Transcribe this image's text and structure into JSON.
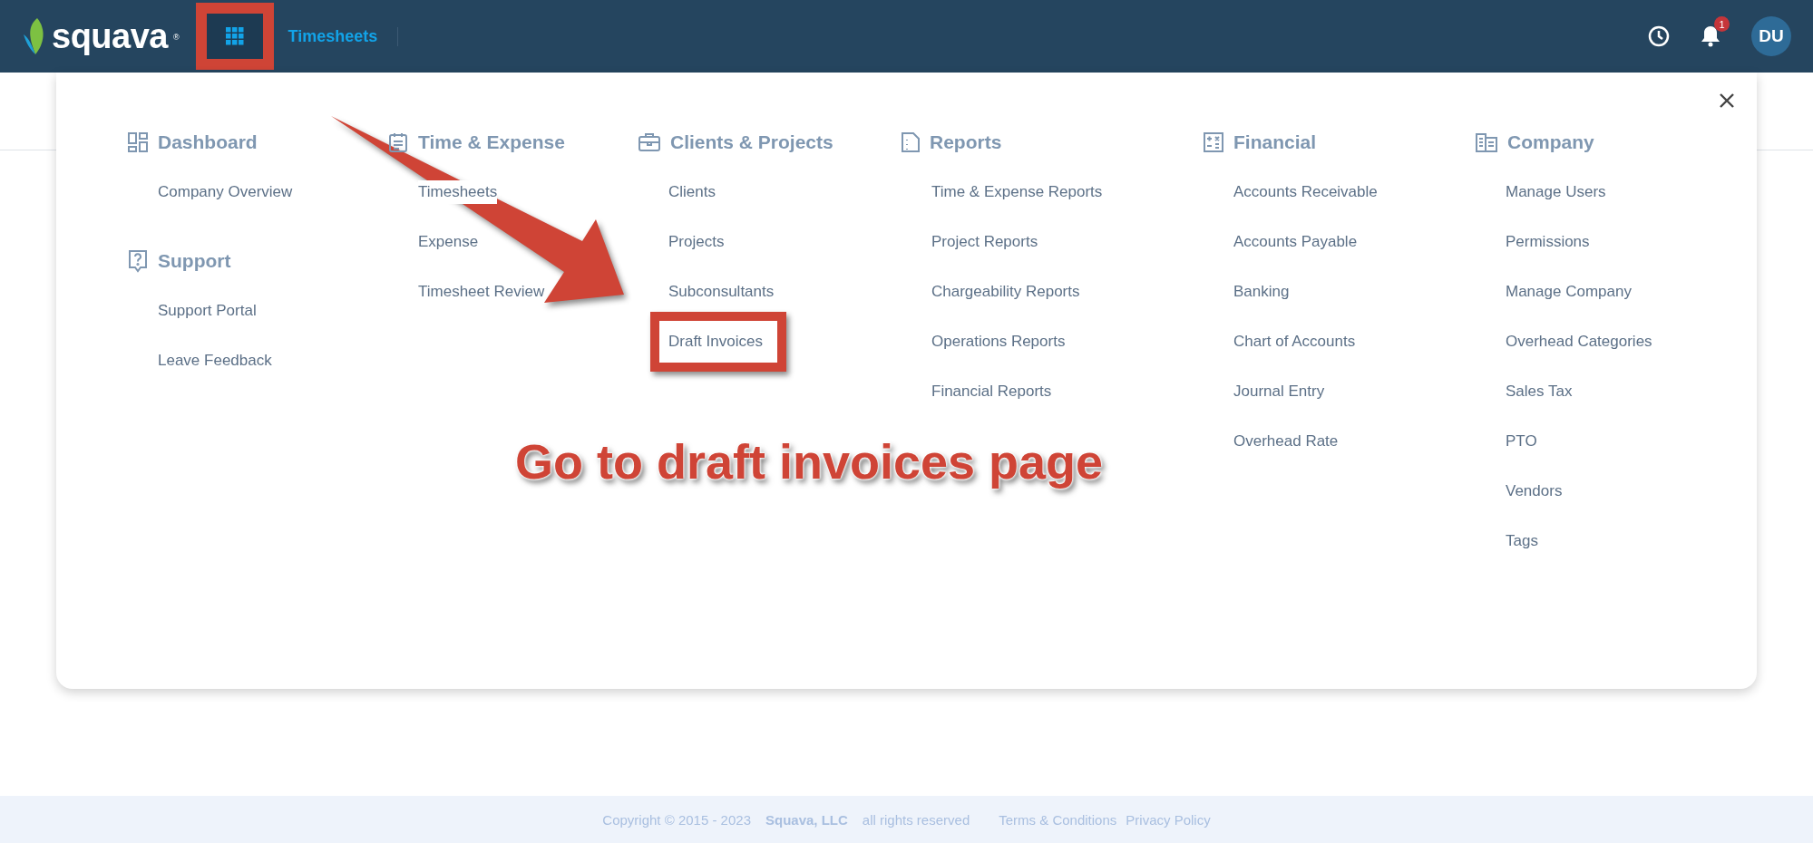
{
  "header": {
    "logo": {
      "name": "squava",
      "mark": "®"
    },
    "apps_button": {
      "boxed": true
    },
    "app_title": "Timesheets",
    "notifications": {
      "badge": "1"
    },
    "avatar": "DU"
  },
  "menu": {
    "columns": [
      {
        "sections": [
          {
            "title": "Dashboard",
            "items": [
              {
                "label": "Company Overview",
                "boxed": false
              }
            ]
          },
          {
            "title": "Support",
            "items": [
              {
                "label": "Support Portal",
                "boxed": false
              },
              {
                "label": "Leave Feedback",
                "boxed": false
              }
            ]
          }
        ]
      },
      {
        "sections": [
          {
            "title": "Time & Expense",
            "items": [
              {
                "label": "Timesheets",
                "boxed": false
              },
              {
                "label": "Expense",
                "boxed": false
              },
              {
                "label": "Timesheet Review",
                "boxed": false
              }
            ]
          }
        ]
      },
      {
        "sections": [
          {
            "title": "Clients & Projects",
            "items": [
              {
                "label": "Clients",
                "boxed": false
              },
              {
                "label": "Projects",
                "boxed": false
              },
              {
                "label": "Subconsultants",
                "boxed": false
              },
              {
                "label": "Draft Invoices",
                "boxed": true
              }
            ]
          }
        ]
      },
      {
        "sections": [
          {
            "title": "Reports",
            "items": [
              {
                "label": "Time & Expense Reports",
                "boxed": false
              },
              {
                "label": "Project Reports",
                "boxed": false
              },
              {
                "label": "Chargeability Reports",
                "boxed": false
              },
              {
                "label": "Operations Reports",
                "boxed": false
              },
              {
                "label": "Financial Reports",
                "boxed": false
              }
            ]
          }
        ]
      },
      {
        "sections": [
          {
            "title": "Financial",
            "items": [
              {
                "label": "Accounts Receivable",
                "boxed": false
              },
              {
                "label": "Accounts Payable",
                "boxed": false
              },
              {
                "label": "Banking",
                "boxed": false
              },
              {
                "label": "Chart of Accounts",
                "boxed": false
              },
              {
                "label": "Journal Entry",
                "boxed": false
              },
              {
                "label": "Overhead Rate",
                "boxed": false
              }
            ]
          }
        ]
      },
      {
        "sections": [
          {
            "title": "Company",
            "items": [
              {
                "label": "Manage Users",
                "boxed": false
              },
              {
                "label": "Permissions",
                "boxed": false
              },
              {
                "label": "Manage Company",
                "boxed": false
              },
              {
                "label": "Overhead Categories",
                "boxed": false
              },
              {
                "label": "Sales Tax",
                "boxed": false
              },
              {
                "label": "PTO",
                "boxed": false
              },
              {
                "label": "Vendors",
                "boxed": false
              },
              {
                "label": "Tags",
                "boxed": false
              }
            ]
          }
        ]
      }
    ]
  },
  "annotation": {
    "caption": "Go to draft invoices page"
  },
  "footer": {
    "copyright": "Copyright © 2015 - 2023",
    "company": "Squava, LLC",
    "rights": "all rights reserved",
    "links": [
      "Terms & Conditions",
      "Privacy Policy"
    ]
  }
}
